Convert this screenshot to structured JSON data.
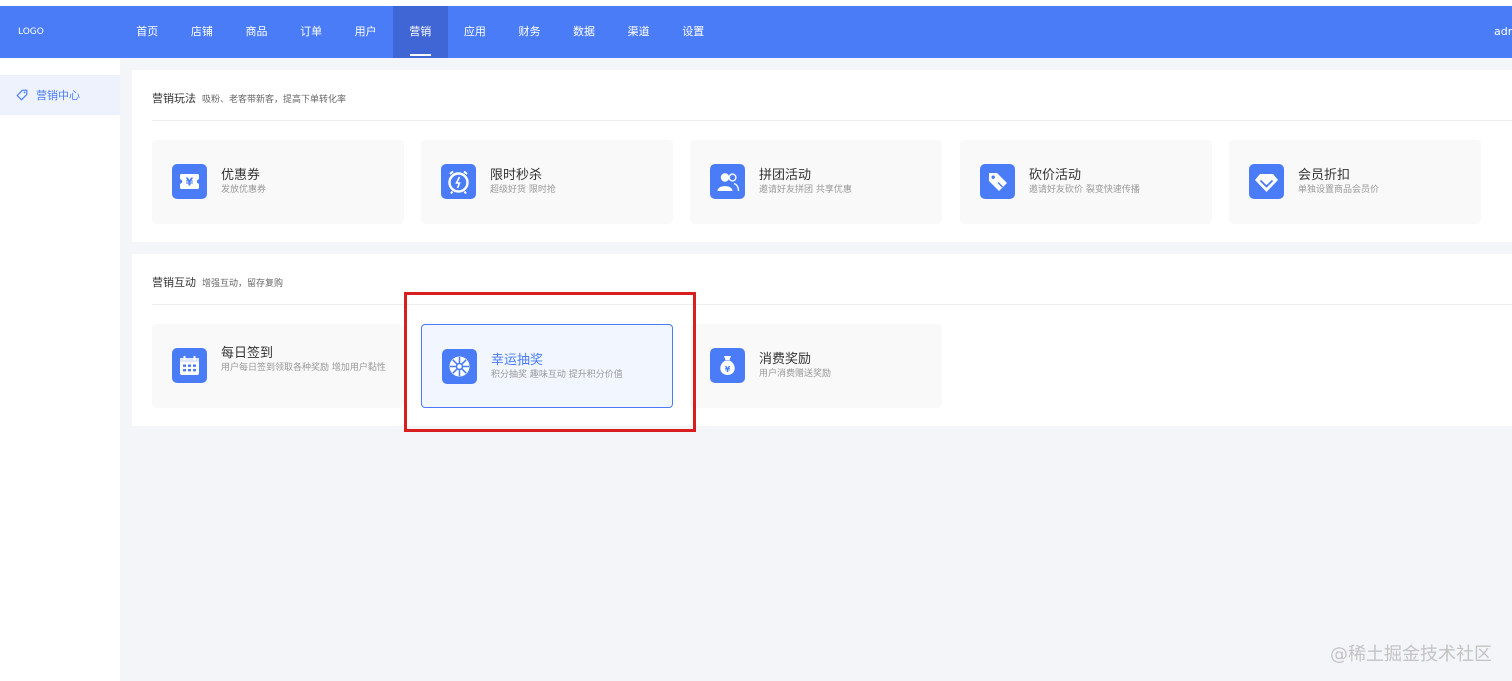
{
  "header": {
    "logo": "LOGO",
    "nav": [
      "首页",
      "店铺",
      "商品",
      "订单",
      "用户",
      "营销",
      "应用",
      "财务",
      "数据",
      "渠道",
      "设置"
    ],
    "active_index": 5,
    "user": "adr"
  },
  "sidebar": {
    "items": [
      {
        "label": "营销中心",
        "icon": "tag-icon"
      }
    ]
  },
  "sections": [
    {
      "title": "营销玩法",
      "subtitle": "吸粉、老客带新客，提高下单转化率",
      "cards": [
        {
          "name": "优惠券",
          "desc": "发放优惠券",
          "icon": "coupon-icon"
        },
        {
          "name": "限时秒杀",
          "desc": "超级好货 限时抢",
          "icon": "alarm-clock-icon"
        },
        {
          "name": "拼团活动",
          "desc": "邀请好友拼团 共享优惠",
          "icon": "group-users-icon"
        },
        {
          "name": "砍价活动",
          "desc": "邀请好友砍价 裂变快速传播",
          "icon": "price-tag-icon"
        },
        {
          "name": "会员折扣",
          "desc": "单独设置商品会员价",
          "icon": "diamond-icon"
        }
      ]
    },
    {
      "title": "营销互动",
      "subtitle": "增强互动，留存复购",
      "cards": [
        {
          "name": "每日签到",
          "desc": "用户每日签到领取各种奖励 增加用户黏性",
          "icon": "calendar-icon"
        },
        {
          "name": "幸运抽奖",
          "desc": "积分抽奖 趣味互动 提升积分价值",
          "icon": "lucky-wheel-icon"
        },
        {
          "name": "消费奖励",
          "desc": "用户消费赠送奖励",
          "icon": "money-bag-icon"
        }
      ]
    }
  ],
  "colors": {
    "primary": "#4a7cf7",
    "nav_active": "#3f66d4",
    "highlight_border": "#d81e1e",
    "main_bg": "#f3f5f8"
  },
  "watermark": "@稀土掘金技术社区"
}
